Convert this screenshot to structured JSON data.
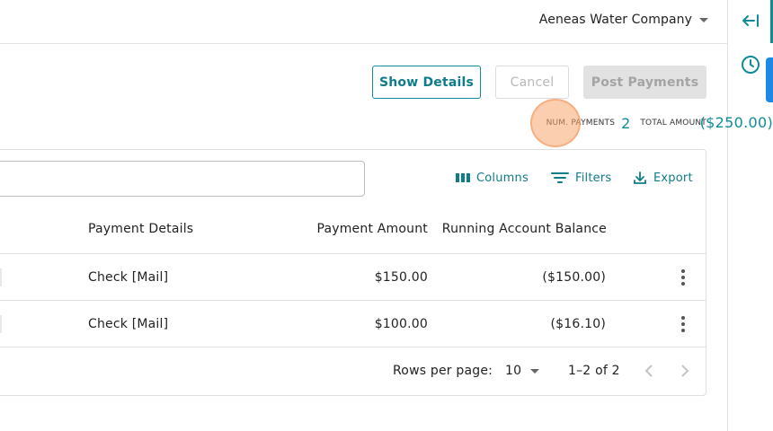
{
  "header": {
    "company": "Aeneas Water Company"
  },
  "rail": {
    "collapse_icon": "collapse-left-icon",
    "history_icon": "clock-icon"
  },
  "actions": {
    "show_details": "Show Details",
    "cancel": "Cancel",
    "post_payments": "Post Payments"
  },
  "summary": {
    "num_payments_label": "NUM. PAYMENTS",
    "num_payments": "2",
    "total_amount_label": "TOTAL AMOUNT",
    "total_amount": "($250.00)"
  },
  "toolbar": {
    "columns": "Columns",
    "filters": "Filters",
    "export": "Export",
    "search_value": ""
  },
  "table": {
    "columns": [
      "Payment Details",
      "Payment Amount",
      "Running Account Balance"
    ],
    "rows": [
      {
        "details": "Check [Mail]",
        "amount": "$150.00",
        "balance": "($150.00)"
      },
      {
        "details": "Check [Mail]",
        "amount": "$100.00",
        "balance": "($16.10)"
      }
    ]
  },
  "pagination": {
    "rows_per_page_label": "Rows per page:",
    "rows_per_page": "10",
    "range": "1–2 of 2"
  },
  "colors": {
    "accent": "#0f8b9a",
    "rail_blue": "#1e88e5",
    "highlight": "#f7a66e"
  }
}
